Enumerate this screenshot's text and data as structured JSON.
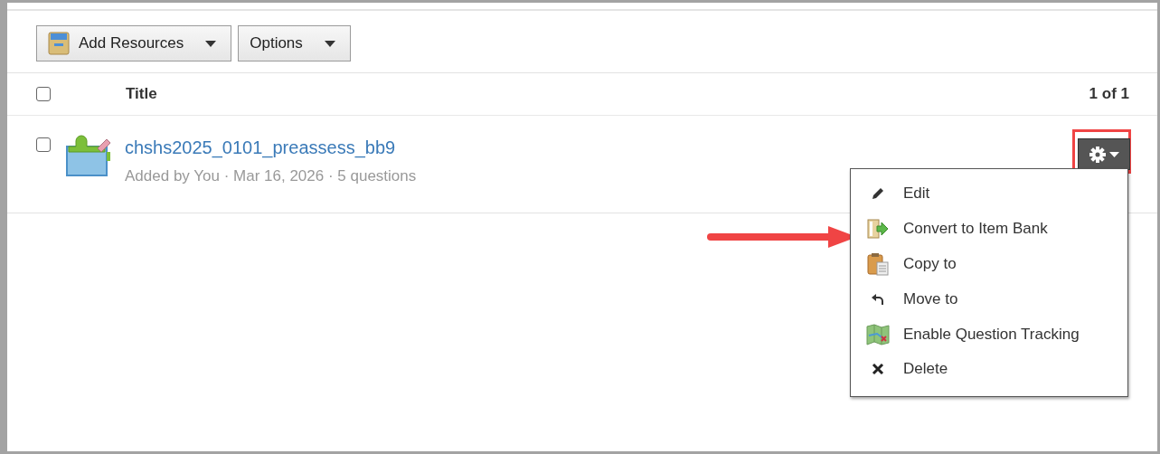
{
  "toolbar": {
    "buttons": [
      {
        "label": "Add Resources",
        "kind": "add"
      },
      {
        "label": "Options",
        "kind": "plain"
      }
    ]
  },
  "table": {
    "select_all": {
      "checked": false
    },
    "column": "Title",
    "pagination": "1 of 1",
    "rows": [
      {
        "checked": false,
        "title": "chshs2025_0101_preassess_bb9",
        "meta": "Added by You · Mar 16, 2026 · 5 questions"
      }
    ]
  },
  "action_menu": {
    "expanded": true,
    "items": [
      {
        "label": "Edit",
        "kind": "edit"
      },
      {
        "label": "Convert to Item Bank",
        "kind": "convert"
      },
      {
        "label": "Copy to",
        "kind": "copy"
      },
      {
        "label": "Move to",
        "kind": "move"
      },
      {
        "label": "Enable Question Tracking",
        "kind": "track"
      },
      {
        "label": "Delete",
        "kind": "delete"
      }
    ]
  }
}
